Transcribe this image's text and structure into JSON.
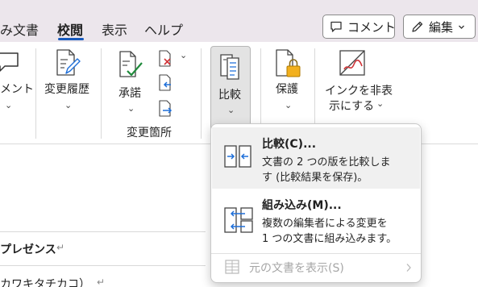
{
  "tabs": [
    {
      "label": "み文書",
      "active": false
    },
    {
      "label": "校閲",
      "active": true
    },
    {
      "label": "表示",
      "active": false
    },
    {
      "label": "ヘルプ",
      "active": false
    }
  ],
  "top_buttons": {
    "comments_label": "コメント",
    "editing_label": "編集"
  },
  "ribbon": {
    "comment_label_partial": "メント",
    "change_history_label": "変更履歴",
    "accept_label": "承諾",
    "changes_group_label": "変更箇所",
    "compare_label": "比較",
    "protect_label": "保護",
    "ink_label_line1": "インクを非表",
    "ink_label_line2": "示にする"
  },
  "compare_menu": {
    "compare_title": "比較(C)...",
    "compare_desc_line1": "文書の 2 つの版を比較しま",
    "compare_desc_line2": "す (比較結果を保存)。",
    "combine_title": "組み込み(M)...",
    "combine_desc_line1": "複数の編集者による変更を",
    "combine_desc_line2": "1 つの文書に組み込みます。",
    "show_source_label": "元の文書を表示(S)"
  },
  "document": {
    "line1": "プレゼンス",
    "line2": "カワキタチカコ）"
  },
  "colors": {
    "accent": "#185abd",
    "tab_background": "#ece6ec",
    "disabled_text": "#a6a6a6"
  }
}
